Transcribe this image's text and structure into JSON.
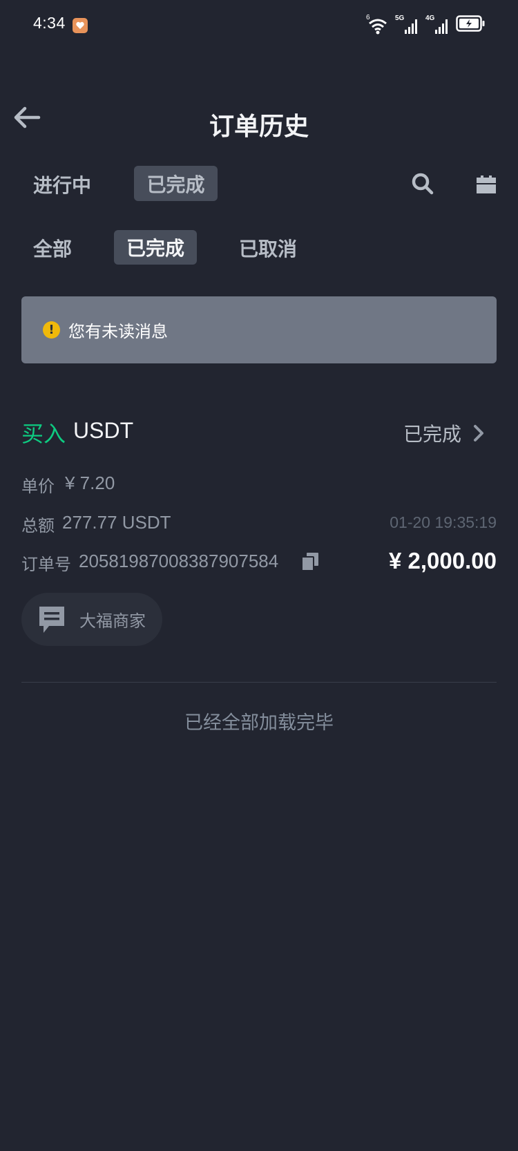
{
  "status_bar": {
    "time": "4:34",
    "icons": [
      "app-notification-icon",
      "wifi-icon",
      "signal-5g-icon",
      "signal-4g-icon",
      "battery-charging-icon"
    ],
    "network_1": "5G",
    "network_2": "4G",
    "wifi_tag": "6"
  },
  "header": {
    "title": "订单历史"
  },
  "tabs": {
    "in_progress": "进行中",
    "completed": "已完成"
  },
  "filters": {
    "all": "全部",
    "completed": "已完成",
    "cancelled": "已取消"
  },
  "notice": {
    "icon_glyph": "!",
    "text": "您有未读消息"
  },
  "order": {
    "side": "买入",
    "asset": "USDT",
    "status": "已完成",
    "price_label": "单价",
    "price_value": "¥ 7.20",
    "total_label": "总额",
    "total_value": "277.77 USDT",
    "time": "01-20 19:35:19",
    "order_no_label": "订单号",
    "order_no_value": "20581987008387907584",
    "amount": "¥ 2,000.00",
    "merchant": "大福商家"
  },
  "footer": {
    "end_text": "已经全部加载完毕"
  },
  "colors": {
    "background": "#222530",
    "buy_green": "#0ecb81",
    "notice_bg": "#707785",
    "warning_yellow": "#f0b90b",
    "tab_active_bg": "#474d5a"
  }
}
